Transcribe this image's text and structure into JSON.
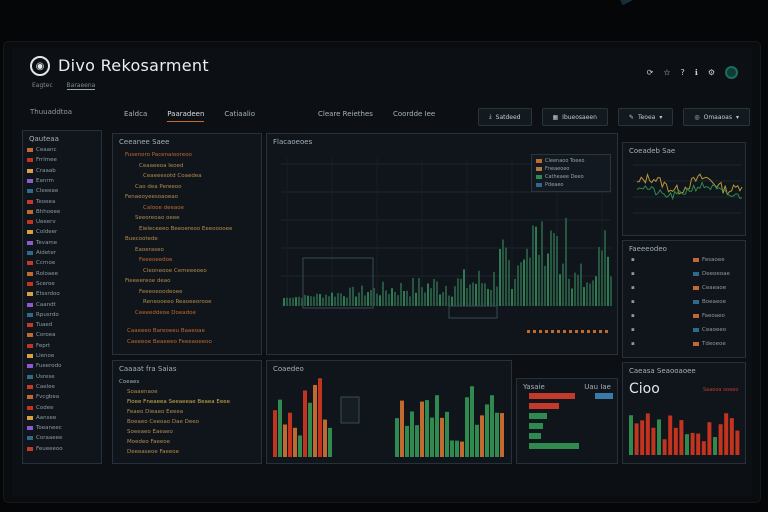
{
  "app": {
    "title": "Divo Rekosarment",
    "sub_tabs": [
      "Eagtec",
      "Baraeena"
    ],
    "status_icons": [
      "⟳",
      "☆",
      "?",
      "ℹ",
      "⚙"
    ]
  },
  "nav": {
    "left_label": "Thuuaddtoa",
    "tabs": [
      "Ealdca",
      "Paaradeen",
      "Catiaalio"
    ],
    "tabs2": [
      "Cleare Reiethes",
      "Coordde Iee"
    ],
    "buttons": [
      "Satdeed",
      "Ibueosaeen",
      "Teoea",
      "Omaaoas"
    ]
  },
  "panels": {
    "tree_title": "Qauteaa",
    "tree_items": [
      "Ceaanc",
      "Frrlmee",
      "Craaab",
      "Eanrm",
      "Cleeeae",
      "Teoeea",
      "Bhhoeee",
      "Ueeerv",
      "Coldeer",
      "Tevame",
      "Aideter",
      "Ccrnoe",
      "Roloaee",
      "Sceroe",
      "Etssrdoo",
      "Caandt",
      "Rpusrdo",
      "Tuaed",
      "Coroea",
      "Feprt",
      "Llenoe",
      "Fueerodo",
      "Usrese",
      "Caelee",
      "Fvcgbea",
      "Codee",
      "Aansee",
      "Toeaneec",
      "Coraaeee",
      "Feueeeoo"
    ],
    "logic_title": "Ceeanee Saee",
    "logic_lines": [
      "Fusenoro Pacenaiooreoo",
      "Ceaaeeoa Ieoed",
      "Ceaeeesotd Coaedea",
      "Cao dea Pereeoo",
      "Fenaeoyeesoaoeao",
      "Calooe deeaoe",
      "Seeoreoao oeee",
      "Eieleceeeo Beeoereoo Eeeooooee",
      "Buecootede",
      "Eaoeraseo",
      "Feeeoeedoe",
      "Cleoneooe Cemeeeoeo",
      "Fieeeereoe deao",
      "Feeeoeoodeoee",
      "Reneooeeo Reaoeeorooe",
      "Ceeeeddeoe Doeadoe"
    ],
    "logic_footer": [
      "Caaeeeo Bareoeeu Baaeoae",
      "Caeeeoe Beaeeeo Feeeaoeeoo"
    ],
    "main_title": "Flacaoeoes",
    "legend": [
      "Cleenaoo Toeeo",
      "Fneaeoeo",
      "Catheaee Deeo",
      "Pdeaeo"
    ],
    "mini_title": "Coeadeb Sae",
    "list_title": "Faeeeodeo",
    "list_right": [
      "Fesaoee",
      "Deeoeoae",
      "Ceaeaoe",
      "Boeaeoe",
      "Faeoaeo",
      "Ceaoeeo",
      "Tdeoeoe"
    ],
    "logic2_title": "Caaaat fra Saias",
    "logic2_sub": "Coeaes",
    "logic2_lines": [
      "Soaaenaoe",
      "Fioee Fneaeea Seeaeeae Beaea Eeee",
      "Feaeo Dieaeo Eeeea",
      "Boeaeo Ceeoao Dae Deeo",
      "Soeeaeo Eaeaeo",
      "Moedeo Faeeoe",
      "Deeeaseoe Faeeoe"
    ],
    "bars_title": "Coaedeo",
    "hbars_title": "Yasaie",
    "hbars_right": "Uau Iae",
    "kpi_title": "Caeasa Seaooaoee",
    "kpi_value": "Cioo",
    "kpi_sub": "Saaeoa ooeeo"
  },
  "colors": {
    "accent_orange": "#c2692f",
    "green": "#2f8a4f",
    "red": "#c2341f",
    "teal": "#1f6b60"
  }
}
